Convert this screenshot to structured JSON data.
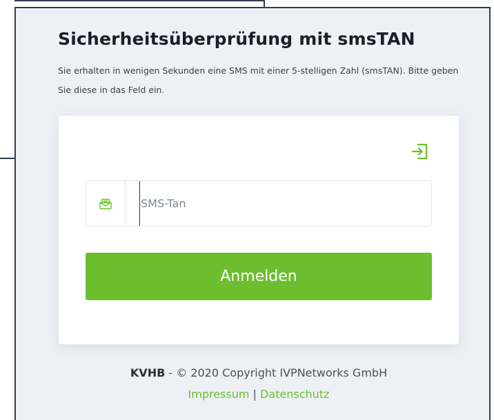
{
  "title": "Sicherheitsüberprüfung mit smsTAN",
  "description": "Sie erhalten in wenigen Sekunden eine SMS mit einer 5-stelligen Zahl (smsTAN). Bitte geben Sie diese in das Feld ein.",
  "form": {
    "login_icon": "login-arrow-icon",
    "input_icon": "sms-envelope-icon",
    "input_placeholder": "SMS-Tan",
    "input_value": "",
    "submit_label": "Anmelden"
  },
  "footer": {
    "brand": "KVHB",
    "copyright": " - © 2020 Copyright IVPNetworks GmbH",
    "links": [
      "Impressum",
      "Datenschutz"
    ],
    "separator": " | "
  },
  "colors": {
    "accent": "#6cbe2f",
    "panel_bg": "#edf1f6",
    "border": "#2f3d4f"
  }
}
